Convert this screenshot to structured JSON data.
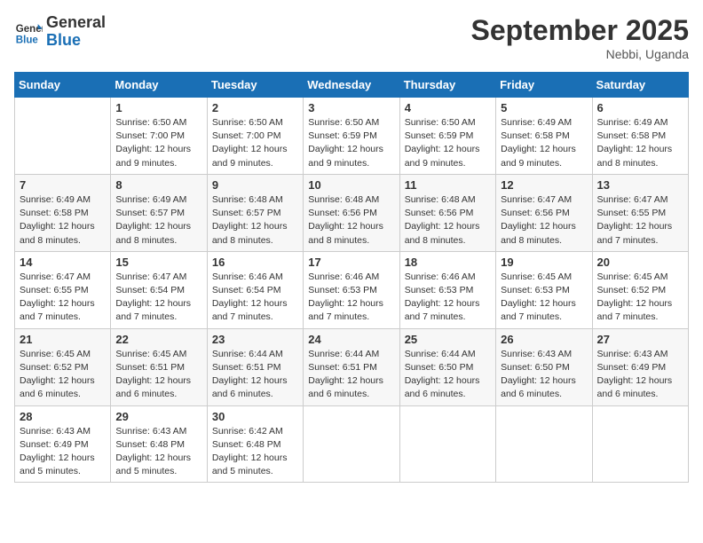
{
  "header": {
    "logo_line1": "General",
    "logo_line2": "Blue",
    "month": "September 2025",
    "location": "Nebbi, Uganda"
  },
  "weekdays": [
    "Sunday",
    "Monday",
    "Tuesday",
    "Wednesday",
    "Thursday",
    "Friday",
    "Saturday"
  ],
  "weeks": [
    [
      {
        "day": "",
        "info": ""
      },
      {
        "day": "1",
        "info": "Sunrise: 6:50 AM\nSunset: 7:00 PM\nDaylight: 12 hours\nand 9 minutes."
      },
      {
        "day": "2",
        "info": "Sunrise: 6:50 AM\nSunset: 7:00 PM\nDaylight: 12 hours\nand 9 minutes."
      },
      {
        "day": "3",
        "info": "Sunrise: 6:50 AM\nSunset: 6:59 PM\nDaylight: 12 hours\nand 9 minutes."
      },
      {
        "day": "4",
        "info": "Sunrise: 6:50 AM\nSunset: 6:59 PM\nDaylight: 12 hours\nand 9 minutes."
      },
      {
        "day": "5",
        "info": "Sunrise: 6:49 AM\nSunset: 6:58 PM\nDaylight: 12 hours\nand 9 minutes."
      },
      {
        "day": "6",
        "info": "Sunrise: 6:49 AM\nSunset: 6:58 PM\nDaylight: 12 hours\nand 8 minutes."
      }
    ],
    [
      {
        "day": "7",
        "info": "Sunrise: 6:49 AM\nSunset: 6:58 PM\nDaylight: 12 hours\nand 8 minutes."
      },
      {
        "day": "8",
        "info": "Sunrise: 6:49 AM\nSunset: 6:57 PM\nDaylight: 12 hours\nand 8 minutes."
      },
      {
        "day": "9",
        "info": "Sunrise: 6:48 AM\nSunset: 6:57 PM\nDaylight: 12 hours\nand 8 minutes."
      },
      {
        "day": "10",
        "info": "Sunrise: 6:48 AM\nSunset: 6:56 PM\nDaylight: 12 hours\nand 8 minutes."
      },
      {
        "day": "11",
        "info": "Sunrise: 6:48 AM\nSunset: 6:56 PM\nDaylight: 12 hours\nand 8 minutes."
      },
      {
        "day": "12",
        "info": "Sunrise: 6:47 AM\nSunset: 6:56 PM\nDaylight: 12 hours\nand 8 minutes."
      },
      {
        "day": "13",
        "info": "Sunrise: 6:47 AM\nSunset: 6:55 PM\nDaylight: 12 hours\nand 7 minutes."
      }
    ],
    [
      {
        "day": "14",
        "info": "Sunrise: 6:47 AM\nSunset: 6:55 PM\nDaylight: 12 hours\nand 7 minutes."
      },
      {
        "day": "15",
        "info": "Sunrise: 6:47 AM\nSunset: 6:54 PM\nDaylight: 12 hours\nand 7 minutes."
      },
      {
        "day": "16",
        "info": "Sunrise: 6:46 AM\nSunset: 6:54 PM\nDaylight: 12 hours\nand 7 minutes."
      },
      {
        "day": "17",
        "info": "Sunrise: 6:46 AM\nSunset: 6:53 PM\nDaylight: 12 hours\nand 7 minutes."
      },
      {
        "day": "18",
        "info": "Sunrise: 6:46 AM\nSunset: 6:53 PM\nDaylight: 12 hours\nand 7 minutes."
      },
      {
        "day": "19",
        "info": "Sunrise: 6:45 AM\nSunset: 6:53 PM\nDaylight: 12 hours\nand 7 minutes."
      },
      {
        "day": "20",
        "info": "Sunrise: 6:45 AM\nSunset: 6:52 PM\nDaylight: 12 hours\nand 7 minutes."
      }
    ],
    [
      {
        "day": "21",
        "info": "Sunrise: 6:45 AM\nSunset: 6:52 PM\nDaylight: 12 hours\nand 6 minutes."
      },
      {
        "day": "22",
        "info": "Sunrise: 6:45 AM\nSunset: 6:51 PM\nDaylight: 12 hours\nand 6 minutes."
      },
      {
        "day": "23",
        "info": "Sunrise: 6:44 AM\nSunset: 6:51 PM\nDaylight: 12 hours\nand 6 minutes."
      },
      {
        "day": "24",
        "info": "Sunrise: 6:44 AM\nSunset: 6:51 PM\nDaylight: 12 hours\nand 6 minutes."
      },
      {
        "day": "25",
        "info": "Sunrise: 6:44 AM\nSunset: 6:50 PM\nDaylight: 12 hours\nand 6 minutes."
      },
      {
        "day": "26",
        "info": "Sunrise: 6:43 AM\nSunset: 6:50 PM\nDaylight: 12 hours\nand 6 minutes."
      },
      {
        "day": "27",
        "info": "Sunrise: 6:43 AM\nSunset: 6:49 PM\nDaylight: 12 hours\nand 6 minutes."
      }
    ],
    [
      {
        "day": "28",
        "info": "Sunrise: 6:43 AM\nSunset: 6:49 PM\nDaylight: 12 hours\nand 5 minutes."
      },
      {
        "day": "29",
        "info": "Sunrise: 6:43 AM\nSunset: 6:48 PM\nDaylight: 12 hours\nand 5 minutes."
      },
      {
        "day": "30",
        "info": "Sunrise: 6:42 AM\nSunset: 6:48 PM\nDaylight: 12 hours\nand 5 minutes."
      },
      {
        "day": "",
        "info": ""
      },
      {
        "day": "",
        "info": ""
      },
      {
        "day": "",
        "info": ""
      },
      {
        "day": "",
        "info": ""
      }
    ]
  ]
}
